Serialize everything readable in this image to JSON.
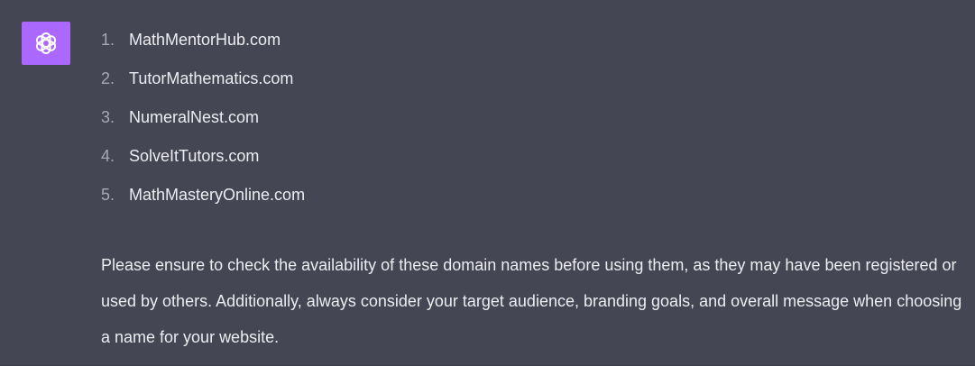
{
  "message": {
    "avatar_icon": "openai-logo-icon",
    "avatar_color": "#ab68ff",
    "background": "#444654",
    "list_items": [
      {
        "number": "1.",
        "text": "MathMentorHub.com"
      },
      {
        "number": "2.",
        "text": "TutorMathematics.com"
      },
      {
        "number": "3.",
        "text": "NumeralNest.com"
      },
      {
        "number": "4.",
        "text": "SolveItTutors.com"
      },
      {
        "number": "5.",
        "text": "MathMasteryOnline.com"
      }
    ],
    "paragraph": "Please ensure to check the availability of these domain names before using them, as they may have been registered or used by others. Additionally, always consider your target audience, branding goals, and overall message when choosing a name for your website."
  }
}
